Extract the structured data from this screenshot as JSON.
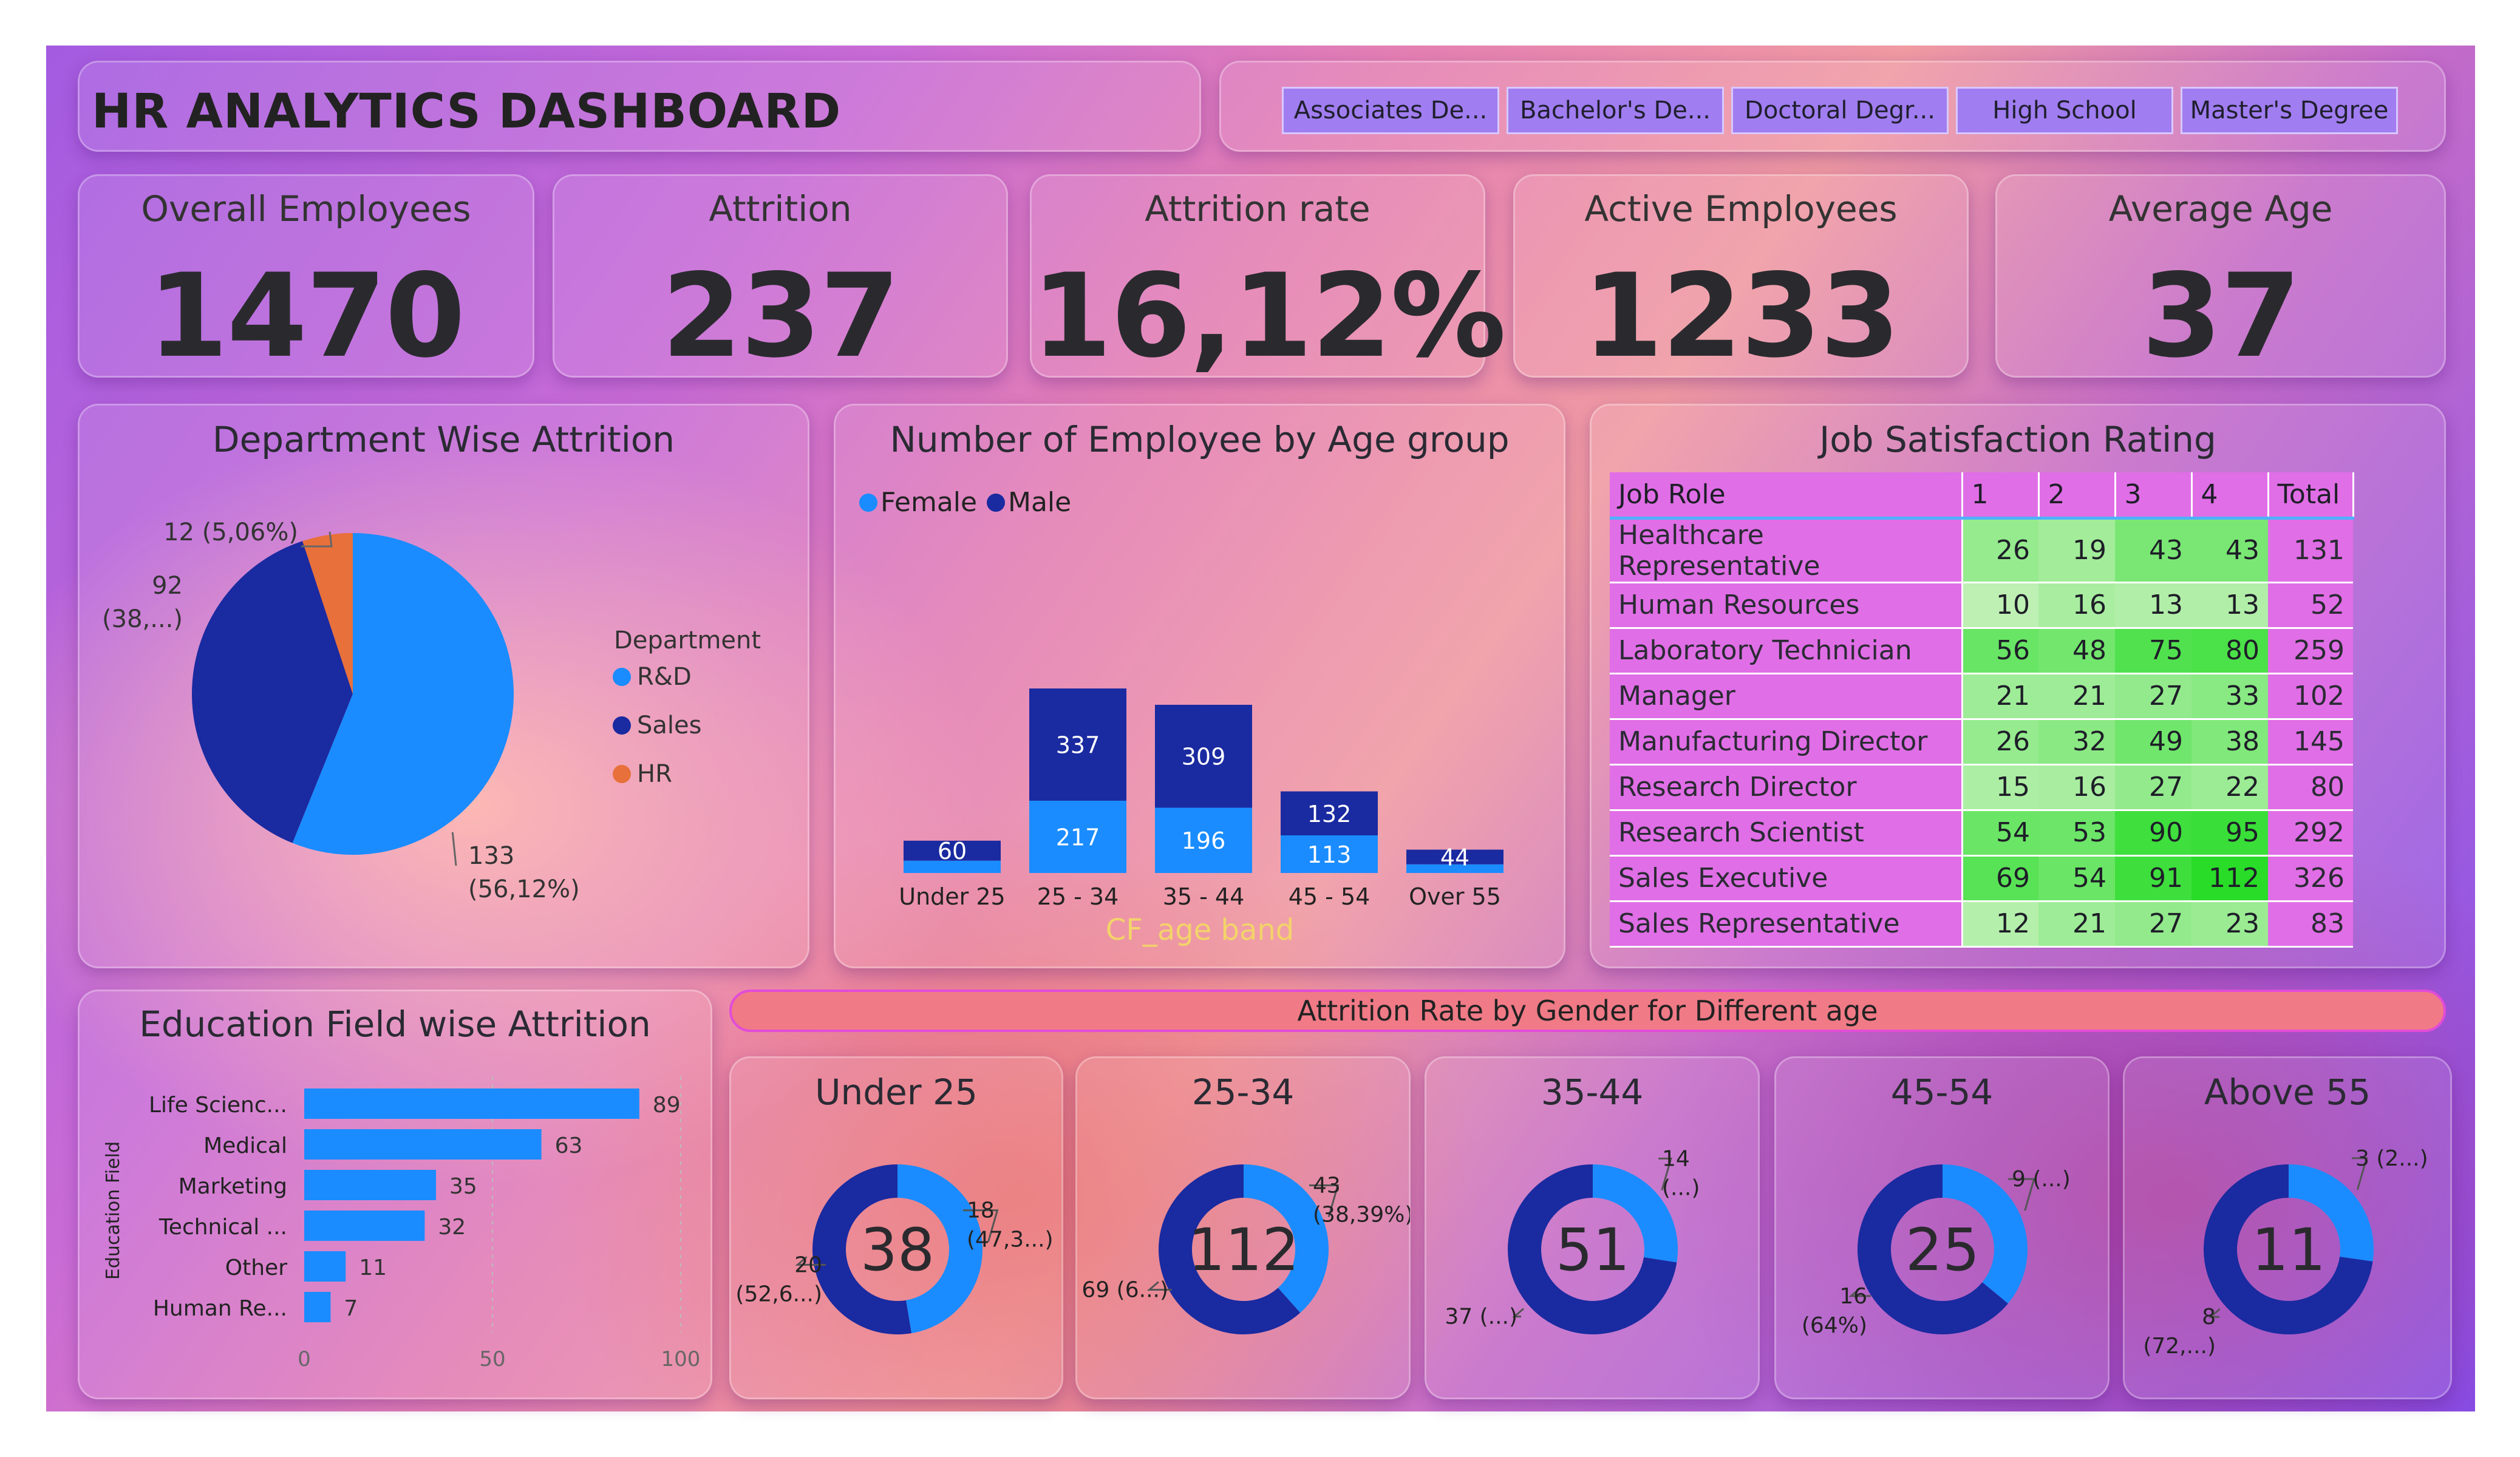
{
  "dashboard": {
    "title": "HR ANALYTICS DASHBOARD",
    "filters": [
      "Associates De...",
      "Bachelor's De...",
      "Doctoral Degr...",
      "High School",
      "Master's Degree"
    ]
  },
  "kpis": [
    {
      "label": "Overall Employees",
      "value": "1470"
    },
    {
      "label": "Attrition",
      "value": "237"
    },
    {
      "label": "Attrition rate",
      "value": "16,12%"
    },
    {
      "label": "Active Employees",
      "value": "1233"
    },
    {
      "label": "Average Age",
      "value": "37"
    }
  ],
  "colors": {
    "light_blue": "#1a8cff",
    "navy": "#1a2aa0",
    "orange": "#e8703a",
    "green_light": "#b8f0b0",
    "green_dark": "#3ce03c",
    "pink": "#e06ee6"
  },
  "chart_data": [
    {
      "id": "dept",
      "type": "pie",
      "title": "Department Wise Attrition",
      "legend_title": "Department",
      "legend_position": "right",
      "slices": [
        {
          "name": "R&D",
          "value": 133,
          "label_lines": [
            "133",
            "(56,12%)"
          ],
          "color": "#1a8cff"
        },
        {
          "name": "Sales",
          "value": 92,
          "label_lines": [
            "92",
            "(38,...)"
          ],
          "color": "#1a2aa0"
        },
        {
          "name": "HR",
          "value": 12,
          "label_lines": [
            "12 (5,06%)"
          ],
          "color": "#e8703a"
        }
      ]
    },
    {
      "id": "age",
      "type": "bar",
      "stacked": true,
      "title": "Number of Employee by Age group",
      "xlabel": "CF_age band",
      "legend_position": "top-left",
      "categories": [
        "Under 25",
        "25 - 34",
        "35 - 44",
        "45 - 54",
        "Over 55"
      ],
      "series": [
        {
          "name": "Female",
          "color": "#1a8cff",
          "values": [
            37,
            217,
            196,
            113,
            26
          ]
        },
        {
          "name": "Male",
          "color": "#1a2aa0",
          "values": [
            60,
            337,
            309,
            132,
            44
          ]
        }
      ],
      "data_labels": {
        "Female": [
          "",
          "217",
          "196",
          "113",
          ""
        ],
        "Male": [
          "60",
          "337",
          "309",
          "132",
          "44"
        ]
      }
    },
    {
      "id": "jobsat",
      "type": "table",
      "title": "Job Satisfaction Rating",
      "columns": [
        "Job Role",
        "1",
        "2",
        "3",
        "4",
        "Total"
      ],
      "rows": [
        [
          "Healthcare Representative",
          26,
          19,
          43,
          43,
          131
        ],
        [
          "Human Resources",
          10,
          16,
          13,
          13,
          52
        ],
        [
          "Laboratory Technician",
          56,
          48,
          75,
          80,
          259
        ],
        [
          "Manager",
          21,
          21,
          27,
          33,
          102
        ],
        [
          "Manufacturing Director",
          26,
          32,
          49,
          38,
          145
        ],
        [
          "Research Director",
          15,
          16,
          27,
          22,
          80
        ],
        [
          "Research Scientist",
          54,
          53,
          90,
          95,
          292
        ],
        [
          "Sales Executive",
          69,
          54,
          91,
          112,
          326
        ],
        [
          "Sales Representative",
          12,
          21,
          27,
          23,
          83
        ]
      ]
    },
    {
      "id": "edu",
      "type": "bar",
      "orientation": "horizontal",
      "title": "Education Field wise Attrition",
      "ylabel": "Education Field",
      "categories": [
        "Life Scienc...",
        "Medical",
        "Marketing",
        "Technical ...",
        "Other",
        "Human Re..."
      ],
      "values": [
        89,
        63,
        35,
        32,
        11,
        7
      ],
      "xlim": [
        0,
        100
      ],
      "xticks": [
        "0",
        "50",
        "100"
      ],
      "color": "#1a8cff"
    },
    {
      "id": "gender",
      "type": "pie",
      "title": "Attrition Rate by Gender for Different age",
      "donuts": [
        {
          "title": "Under 25",
          "center": "38",
          "male": 20,
          "female": 18,
          "male_label": [
            "20",
            "(52,6...)"
          ],
          "female_label": [
            "18",
            "(47,3...)"
          ]
        },
        {
          "title": "25-34",
          "center": "112",
          "male": 69,
          "female": 43,
          "male_label": [
            "69 (6...)"
          ],
          "female_label": [
            "43",
            "(38,39%)"
          ]
        },
        {
          "title": "35-44",
          "center": "51",
          "male": 37,
          "female": 14,
          "male_label": [
            "37 (...)"
          ],
          "female_label": [
            "14",
            "(...)"
          ]
        },
        {
          "title": "45-54",
          "center": "25",
          "male": 16,
          "female": 9,
          "male_label": [
            "16",
            "(64%)"
          ],
          "female_label": [
            "9 (...)"
          ]
        },
        {
          "title": "Above 55",
          "center": "11",
          "male": 8,
          "female": 3,
          "male_label": [
            "8",
            "(72,...)"
          ],
          "female_label": [
            "3 (2...)"
          ]
        }
      ]
    }
  ]
}
